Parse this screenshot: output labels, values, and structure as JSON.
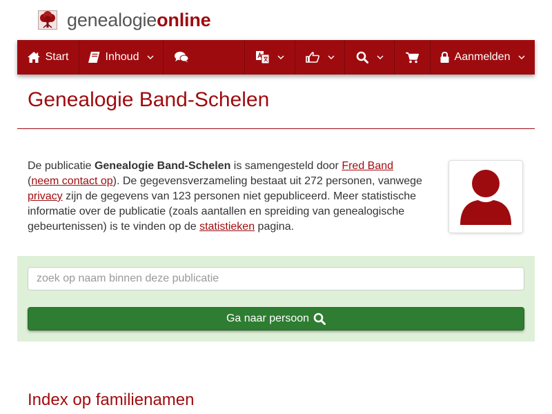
{
  "brand": {
    "name_light": "genealogie",
    "name_bold": "online",
    "logo_icon": "tree-icon",
    "accent_color": "#9e0b0f"
  },
  "navbar": {
    "start": "Start",
    "inhoud": "Inhoud",
    "aanmelden": "Aanmelden",
    "icons": [
      "home-icon",
      "book-icon",
      "comments-icon",
      "language-icon",
      "thumbs-up-icon",
      "search-icon",
      "cart-icon",
      "lock-icon"
    ]
  },
  "page": {
    "title": "Genealogie Band-Schelen"
  },
  "intro": {
    "t1": "De publicatie ",
    "pub_name": "Genealogie Band-Schelen",
    "t2": " is samengesteld door ",
    "author": "Fred Band",
    "t3": "(",
    "contact": "neem contact op",
    "t4": "). De gegevensverzameling bestaat uit 272 personen, vanwege ",
    "privacy": "privacy",
    "t5": " zijn de gegevens van 123 personen niet gepubliceerd. Meer statistische informatie over de publicatie (zoals aantallen en spreiding van genealogische gebeurtenissen) is te vinden op de ",
    "stats": "statistieken",
    "t6": " pagina."
  },
  "search": {
    "placeholder": "zoek op naam binnen deze publicatie",
    "value": "",
    "button_label": "Ga naar persoon",
    "panel_color": "#dff0d8",
    "button_color": "#2e7d32"
  },
  "sections": {
    "index_title": "Index op familienamen"
  }
}
